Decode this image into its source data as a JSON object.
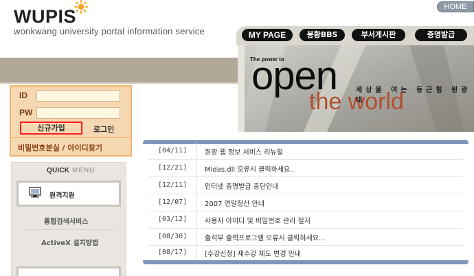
{
  "header": {
    "logo": "WUPIS",
    "subtitle": "wonkwang university portal information service",
    "home_label": "HOME"
  },
  "nav": {
    "mypage": "MY PAGE",
    "bbs": "봉황BBS",
    "dept_board": "부서게시판",
    "cert": "증명발급"
  },
  "hero": {
    "tagline": "The power to",
    "open": "open",
    "world": "the world",
    "korean": "세상을 여는 등근힘 원광대"
  },
  "login": {
    "id_label": "ID",
    "pw_label": "PW",
    "id_value": "",
    "pw_value": "",
    "signup": "신규가입",
    "login": "로그인",
    "find": "비밀번호분실 / 아이디찾기"
  },
  "quick": {
    "title_bold": "QUICK",
    "title_light": " MENU",
    "remote": "원격지원",
    "search_service": "통합검색서비스",
    "activex": "ActiveX 설치방법"
  },
  "notices": [
    {
      "date": "[04/11]",
      "title": "원광 웹 정보 서비스 리뉴얼"
    },
    {
      "date": "[12/21]",
      "title": "Midas.dll 오류시 클릭하세요.."
    },
    {
      "date": "[12/11]",
      "title": "인터넷 증명발급 중단안내"
    },
    {
      "date": "[12/07]",
      "title": "2007 연말정산 안내"
    },
    {
      "date": "[03/12]",
      "title": "사용자 아이디 및 비밀번호 관리 철저"
    },
    {
      "date": "[08/30]",
      "title": "출석부 출력프로그램 오류시 클릭하세요..."
    },
    {
      "date": "[08/17]",
      "title": "[수강신청] 재수강 제도 변경 안내"
    }
  ],
  "colors": {
    "accent_orange": "#f1b46b",
    "notice_bar": "#7f96bd",
    "hero_world": "#b0502c",
    "signup_border": "#ff1a1a"
  }
}
